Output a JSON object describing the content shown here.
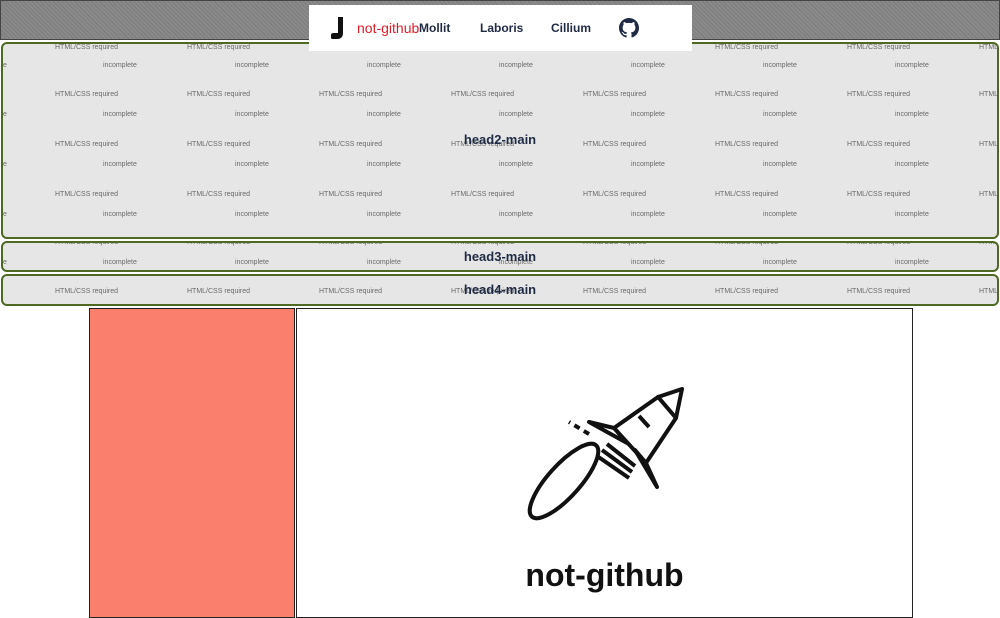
{
  "header": {
    "brand": "not-github",
    "links": [
      "Mollit",
      "Laboris",
      "Cillium"
    ],
    "github_icon": "github-icon"
  },
  "sections": [
    {
      "id": "head2",
      "title": "head2-main"
    },
    {
      "id": "head3",
      "title": "head3-main"
    },
    {
      "id": "head4",
      "title": "head4-main"
    }
  ],
  "background_text": {
    "html_css": "HTML/CSS required",
    "incomplete": "incomplete"
  },
  "hero": {
    "title": "not-github",
    "icon": "rocket-icon"
  },
  "colors": {
    "brand": "#e11d2a",
    "section_border": "#4e6a22",
    "section_bg": "#e6e6e6",
    "sidebar_panel": "#fa7f6d"
  }
}
